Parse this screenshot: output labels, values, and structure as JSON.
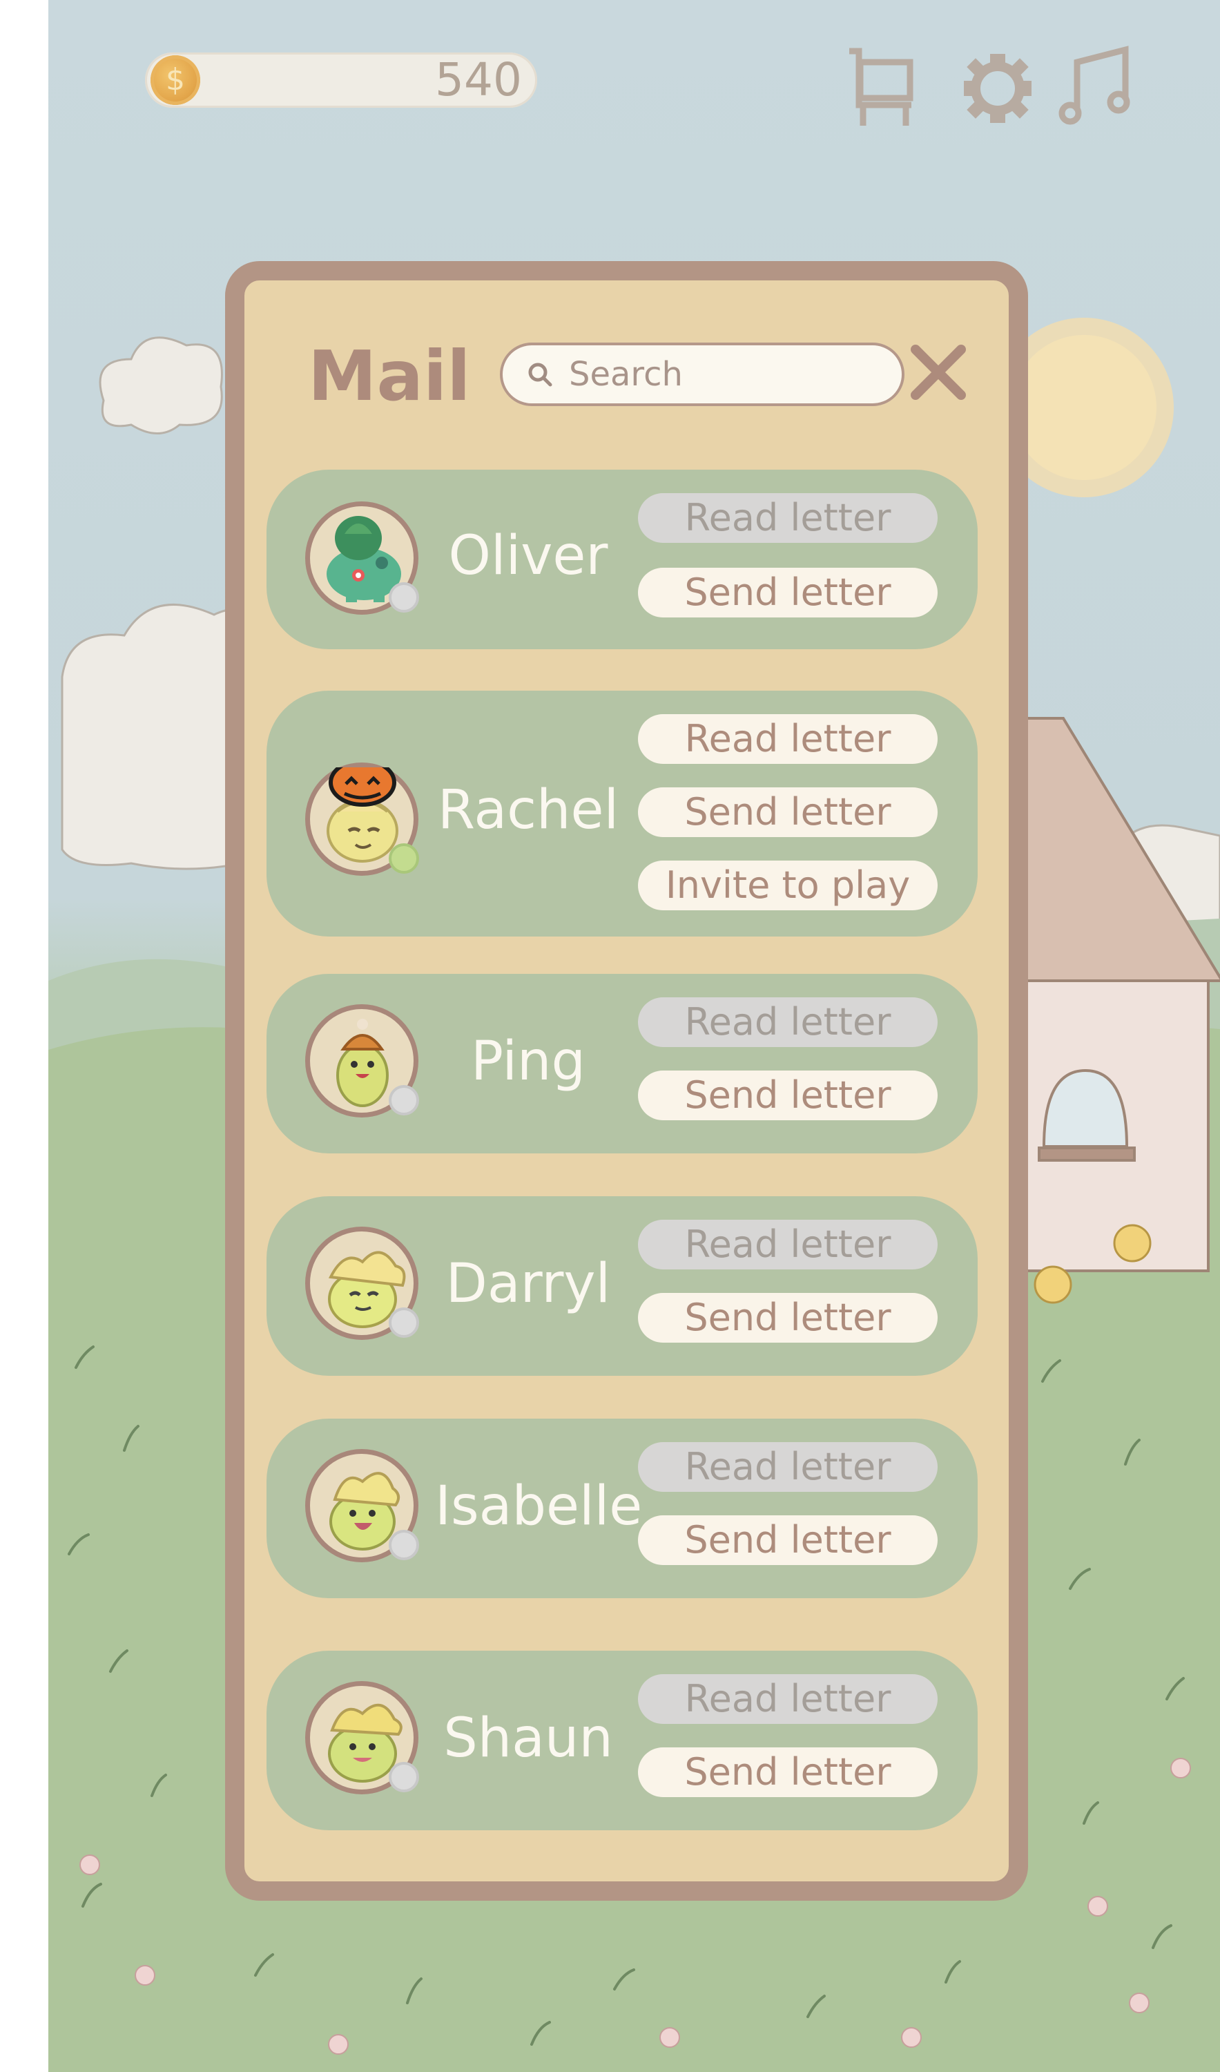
{
  "hud": {
    "coins": "540",
    "coin_symbol": "$",
    "icons": [
      "shop-cart-icon",
      "settings-gear-icon",
      "music-note-icon"
    ]
  },
  "mail": {
    "title": "Mail",
    "search_placeholder": "Search",
    "close_icon": "close-icon"
  },
  "friends": [
    {
      "name": "Oliver",
      "status": "offline",
      "read_label": "Read letter",
      "read_enabled": false,
      "send_label": "Send letter"
    },
    {
      "name": "Rachel",
      "status": "online",
      "read_label": "Read letter",
      "read_enabled": true,
      "send_label": "Send letter",
      "invite_label": "Invite to play"
    },
    {
      "name": "Ping",
      "status": "offline",
      "read_label": "Read letter",
      "read_enabled": false,
      "send_label": "Send letter"
    },
    {
      "name": "Darryl",
      "status": "offline",
      "read_label": "Read letter",
      "read_enabled": false,
      "send_label": "Send letter"
    },
    {
      "name": "Isabelle",
      "status": "offline",
      "read_label": "Read letter",
      "read_enabled": false,
      "send_label": "Send letter"
    },
    {
      "name": "Shaun",
      "status": "offline",
      "read_label": "Read letter",
      "read_enabled": false,
      "send_label": "Send letter"
    }
  ],
  "colors": {
    "panel_border": "#b39585",
    "panel_fill": "#e8d3a9",
    "card_fill": "#b4c4a5",
    "button_active": "#faf4e9",
    "button_disabled": "#d7d6d5"
  }
}
